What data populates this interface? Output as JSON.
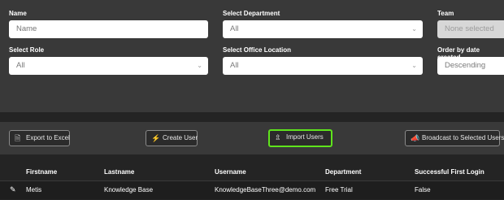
{
  "filters": {
    "name": {
      "label": "Name",
      "placeholder": "Name"
    },
    "department": {
      "label": "Select Department",
      "value": "All"
    },
    "team": {
      "label": "Team",
      "value": "None selected"
    },
    "role": {
      "label": "Select Role",
      "value": "All"
    },
    "office": {
      "label": "Select Office Location",
      "value": "All"
    },
    "order": {
      "label": "Order by date created",
      "value": "Descending"
    }
  },
  "toolbar": {
    "export": "Export to Excel",
    "create": "Create User",
    "import": "Import Users",
    "broadcast": "Broadcast to Selected Users"
  },
  "table": {
    "headers": [
      "Firstname",
      "Lastname",
      "Username",
      "Department",
      "Successful First Login"
    ],
    "rows": [
      {
        "firstname": "Metis",
        "lastname": "Knowledge Base",
        "username": "KnowledgeBaseThree@demo.com",
        "department": "Free Trial",
        "first_login": "False"
      }
    ]
  },
  "colors": {
    "highlight": "#5fe41c",
    "panel": "#393939",
    "background": "#242424"
  }
}
